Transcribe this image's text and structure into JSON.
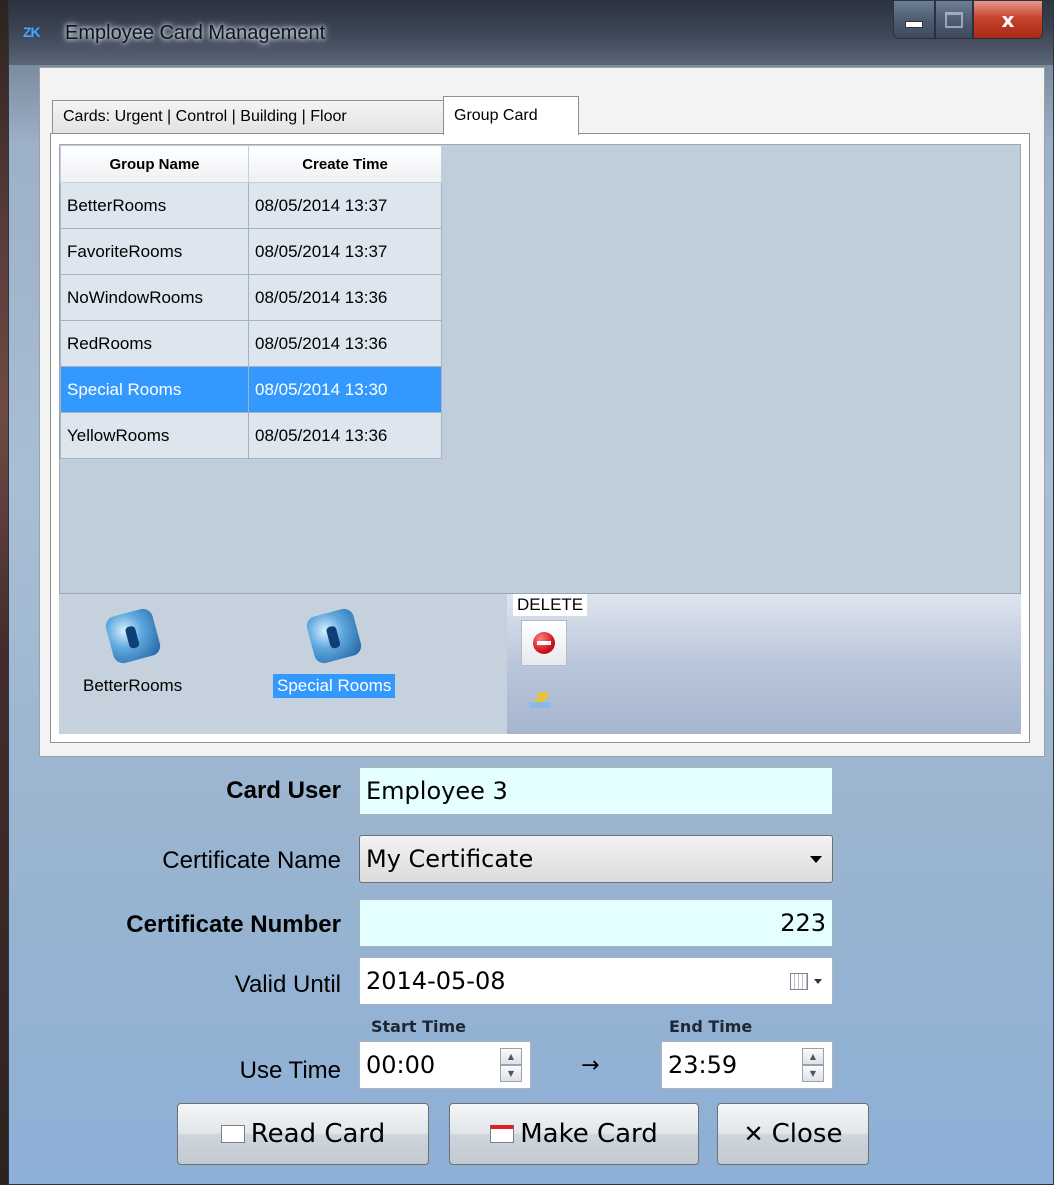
{
  "window": {
    "icon_text": "ZK",
    "title": "Employee Card Management"
  },
  "caption": {
    "close_glyph": "x"
  },
  "tabs": [
    {
      "label": "Cards: Urgent | Control | Building | Floor"
    },
    {
      "label": "Group Card"
    }
  ],
  "grid": {
    "headers": [
      "Group Name",
      "Create Time"
    ],
    "rows": [
      {
        "name": "BetterRooms",
        "time": "08/05/2014 13:37"
      },
      {
        "name": "FavoriteRooms",
        "time": "08/05/2014 13:37"
      },
      {
        "name": "NoWindowRooms",
        "time": "08/05/2014 13:36"
      },
      {
        "name": "RedRooms",
        "time": "08/05/2014 13:36"
      },
      {
        "name": "Special Rooms",
        "time": "08/05/2014 13:30"
      },
      {
        "name": "YellowRooms",
        "time": "08/05/2014 13:36"
      }
    ],
    "selected_row": 4
  },
  "groups_panel": {
    "tiles": [
      {
        "label": "BetterRooms",
        "selected": false
      },
      {
        "label": "Special Rooms",
        "selected": true
      }
    ],
    "delete_label": "DELETE"
  },
  "form": {
    "card_user_label": "Card User",
    "card_user_value": "Employee 3",
    "certificate_name_label": "Certificate Name",
    "certificate_name_value": "My Certificate",
    "certificate_number_label": "Certificate Number",
    "certificate_number_value": "223",
    "valid_until_label": "Valid Until",
    "valid_until_value": "2014-05-08",
    "start_time_label": "Start Time",
    "end_time_label": "End Time",
    "use_time_label": "Use Time",
    "start_time_value": "00:00",
    "arrow": "→",
    "end_time_value": "23:59"
  },
  "buttons": {
    "read_card": "Read Card",
    "make_card": "Make Card",
    "close": "Close",
    "close_glyph": "✕"
  },
  "colors": {
    "selection": "#3399ff",
    "field_highlight": "#e4ffff",
    "close_button": "#c7432c"
  }
}
